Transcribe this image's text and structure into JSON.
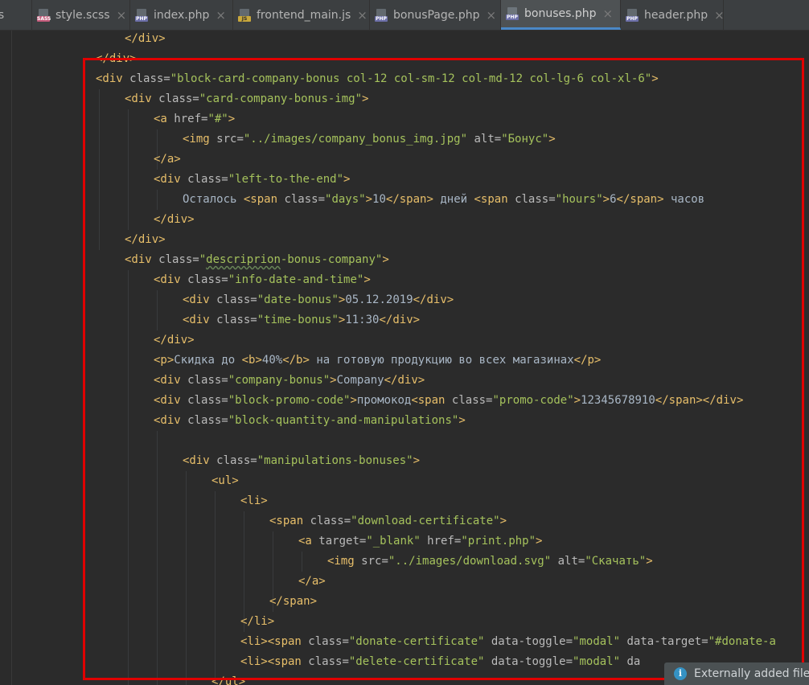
{
  "tabs": [
    {
      "label": "js",
      "icon": "none",
      "active": false,
      "closable": false
    },
    {
      "label": "style.scss",
      "icon": "sass-file-icon",
      "badge": "SASS",
      "active": false,
      "closable": true
    },
    {
      "label": "index.php",
      "icon": "php-file-icon",
      "badge": "PHP",
      "active": false,
      "closable": true
    },
    {
      "label": "frontend_main.js",
      "icon": "js-file-icon",
      "badge": "JS",
      "active": false,
      "closable": true
    },
    {
      "label": "bonusPage.php",
      "icon": "php-file-icon",
      "badge": "PHP",
      "active": false,
      "closable": true
    },
    {
      "label": "bonuses.php",
      "icon": "php-file-icon",
      "badge": "PHP",
      "active": true,
      "closable": true
    },
    {
      "label": "header.php",
      "icon": "php-file-icon",
      "badge": "PHP",
      "active": false,
      "closable": true
    }
  ],
  "tab_close_glyph": "×",
  "code_lines": [
    {
      "indent": 4,
      "tokens": [
        [
          "tag",
          "</div>"
        ]
      ]
    },
    {
      "indent": 3,
      "tokens": [
        [
          "tag",
          "</div>"
        ]
      ]
    },
    {
      "indent": 3,
      "tokens": [
        [
          "tag",
          "<div "
        ],
        [
          "attr",
          "class="
        ],
        [
          "str",
          "\"block-card-company-bonus col-12 col-sm-12 col-md-12 col-lg-6 col-xl-6\""
        ],
        [
          "tag",
          ">"
        ]
      ]
    },
    {
      "indent": 4,
      "tokens": [
        [
          "tag",
          "<div "
        ],
        [
          "attr",
          "class="
        ],
        [
          "str",
          "\"card-company-bonus-img\""
        ],
        [
          "tag",
          ">"
        ]
      ]
    },
    {
      "indent": 5,
      "tokens": [
        [
          "tag",
          "<a "
        ],
        [
          "attr",
          "href="
        ],
        [
          "str",
          "\"#\""
        ],
        [
          "tag",
          ">"
        ]
      ]
    },
    {
      "indent": 6,
      "tokens": [
        [
          "tag",
          "<img "
        ],
        [
          "attr",
          "src="
        ],
        [
          "str",
          "\"../images/company_bonus_img.jpg\""
        ],
        [
          "attr",
          " alt="
        ],
        [
          "str",
          "\"Бонус\""
        ],
        [
          "tag",
          ">"
        ]
      ]
    },
    {
      "indent": 5,
      "tokens": [
        [
          "tag",
          "</a>"
        ]
      ]
    },
    {
      "indent": 5,
      "tokens": [
        [
          "tag",
          "<div "
        ],
        [
          "attr",
          "class="
        ],
        [
          "str",
          "\"left-to-the-end\""
        ],
        [
          "tag",
          ">"
        ]
      ]
    },
    {
      "indent": 6,
      "tokens": [
        [
          "txt",
          "Осталось "
        ],
        [
          "tag",
          "<span "
        ],
        [
          "attr",
          "class="
        ],
        [
          "str",
          "\"days\""
        ],
        [
          "tag",
          ">"
        ],
        [
          "txt",
          "10"
        ],
        [
          "tag",
          "</span>"
        ],
        [
          "txt",
          " дней "
        ],
        [
          "tag",
          "<span "
        ],
        [
          "attr",
          "class="
        ],
        [
          "str",
          "\"hours\""
        ],
        [
          "tag",
          ">"
        ],
        [
          "txt",
          "6"
        ],
        [
          "tag",
          "</span>"
        ],
        [
          "txt",
          " часов"
        ]
      ]
    },
    {
      "indent": 5,
      "tokens": [
        [
          "tag",
          "</div>"
        ]
      ]
    },
    {
      "indent": 4,
      "tokens": [
        [
          "tag",
          "</div>"
        ]
      ]
    },
    {
      "indent": 4,
      "tokens": [
        [
          "tag",
          "<div "
        ],
        [
          "attr",
          "class="
        ],
        [
          "str",
          "\""
        ],
        [
          "typo",
          "descriprion"
        ],
        [
          "str",
          "-bonus-company\""
        ],
        [
          "tag",
          ">"
        ]
      ]
    },
    {
      "indent": 5,
      "tokens": [
        [
          "tag",
          "<div "
        ],
        [
          "attr",
          "class="
        ],
        [
          "str",
          "\"info-date-and-time\""
        ],
        [
          "tag",
          ">"
        ]
      ]
    },
    {
      "indent": 6,
      "tokens": [
        [
          "tag",
          "<div "
        ],
        [
          "attr",
          "class="
        ],
        [
          "str",
          "\"date-bonus\""
        ],
        [
          "tag",
          ">"
        ],
        [
          "txt",
          "05.12.2019"
        ],
        [
          "tag",
          "</div>"
        ]
      ]
    },
    {
      "indent": 6,
      "tokens": [
        [
          "tag",
          "<div "
        ],
        [
          "attr",
          "class="
        ],
        [
          "str",
          "\"time-bonus\""
        ],
        [
          "tag",
          ">"
        ],
        [
          "txt",
          "11:30"
        ],
        [
          "tag",
          "</div>"
        ]
      ]
    },
    {
      "indent": 5,
      "tokens": [
        [
          "tag",
          "</div>"
        ]
      ]
    },
    {
      "indent": 5,
      "tokens": [
        [
          "tag",
          "<p>"
        ],
        [
          "txt",
          "Скидка до "
        ],
        [
          "tag",
          "<b>"
        ],
        [
          "txt",
          "40%"
        ],
        [
          "tag",
          "</b>"
        ],
        [
          "txt",
          " на готовую продукцию во всех магазинах"
        ],
        [
          "tag",
          "</p>"
        ]
      ]
    },
    {
      "indent": 5,
      "tokens": [
        [
          "tag",
          "<div "
        ],
        [
          "attr",
          "class="
        ],
        [
          "str",
          "\"company-bonus\""
        ],
        [
          "tag",
          ">"
        ],
        [
          "txt",
          "Company"
        ],
        [
          "tag",
          "</div>"
        ]
      ]
    },
    {
      "indent": 5,
      "tokens": [
        [
          "tag",
          "<div "
        ],
        [
          "attr",
          "class="
        ],
        [
          "str",
          "\"block-promo-code\""
        ],
        [
          "tag",
          ">"
        ],
        [
          "txt",
          "промокод"
        ],
        [
          "tag",
          "<span "
        ],
        [
          "attr",
          "class="
        ],
        [
          "str",
          "\"promo-code\""
        ],
        [
          "tag",
          ">"
        ],
        [
          "txt",
          "12345678910"
        ],
        [
          "tag",
          "</span></div>"
        ]
      ]
    },
    {
      "indent": 5,
      "tokens": [
        [
          "tag",
          "<div "
        ],
        [
          "attr",
          "class="
        ],
        [
          "str",
          "\"block-quantity-and-manipulations\""
        ],
        [
          "tag",
          ">"
        ]
      ]
    },
    {
      "indent": 0,
      "tokens": []
    },
    {
      "indent": 6,
      "tokens": [
        [
          "tag",
          "<div "
        ],
        [
          "attr",
          "class="
        ],
        [
          "str",
          "\"manipulations-bonuses\""
        ],
        [
          "tag",
          ">"
        ]
      ]
    },
    {
      "indent": 7,
      "tokens": [
        [
          "tag",
          "<ul>"
        ]
      ]
    },
    {
      "indent": 8,
      "tokens": [
        [
          "tag",
          "<li>"
        ]
      ]
    },
    {
      "indent": 9,
      "tokens": [
        [
          "tag",
          "<span "
        ],
        [
          "attr",
          "class="
        ],
        [
          "str",
          "\"download-certificate\""
        ],
        [
          "tag",
          ">"
        ]
      ]
    },
    {
      "indent": 10,
      "tokens": [
        [
          "tag",
          "<a "
        ],
        [
          "attr",
          "target="
        ],
        [
          "str",
          "\"_blank\""
        ],
        [
          "attr",
          " href="
        ],
        [
          "str",
          "\"print.php\""
        ],
        [
          "tag",
          ">"
        ]
      ]
    },
    {
      "indent": 11,
      "tokens": [
        [
          "tag",
          "<img "
        ],
        [
          "attr",
          "src="
        ],
        [
          "str",
          "\"../images/download.svg\""
        ],
        [
          "attr",
          " alt="
        ],
        [
          "str",
          "\"Скачать\""
        ],
        [
          "tag",
          ">"
        ]
      ]
    },
    {
      "indent": 10,
      "tokens": [
        [
          "tag",
          "</a>"
        ]
      ]
    },
    {
      "indent": 9,
      "tokens": [
        [
          "tag",
          "</span>"
        ]
      ]
    },
    {
      "indent": 8,
      "tokens": [
        [
          "tag",
          "</li>"
        ]
      ]
    },
    {
      "indent": 8,
      "tokens": [
        [
          "tag",
          "<li><span "
        ],
        [
          "attr",
          "class="
        ],
        [
          "str",
          "\"donate-certificate\""
        ],
        [
          "attr",
          " data-toggle="
        ],
        [
          "str",
          "\"modal\""
        ],
        [
          "attr",
          " data-target="
        ],
        [
          "str",
          "\"#donate-a"
        ]
      ]
    },
    {
      "indent": 8,
      "tokens": [
        [
          "tag",
          "<li><span "
        ],
        [
          "attr",
          "class="
        ],
        [
          "str",
          "\"delete-certificate\""
        ],
        [
          "attr",
          " data-toggle="
        ],
        [
          "str",
          "\"modal\""
        ],
        [
          "attr",
          " da"
        ]
      ]
    },
    {
      "indent": 7,
      "tokens": [
        [
          "tag",
          "</ul>"
        ]
      ]
    }
  ],
  "notification": {
    "icon": "info-icon",
    "icon_glyph": "i",
    "text": "Externally added files"
  },
  "highlight_color": "#e00000"
}
